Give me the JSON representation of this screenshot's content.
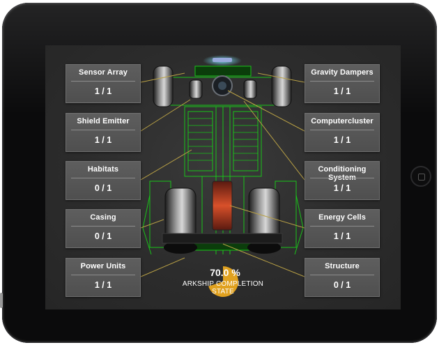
{
  "modules_left": [
    {
      "name": "Sensor Array",
      "count": "1 / 1"
    },
    {
      "name": "Shield Emitter",
      "count": "1 / 1"
    },
    {
      "name": "Habitats",
      "count": "0 / 1"
    },
    {
      "name": "Casing",
      "count": "0 / 1"
    },
    {
      "name": "Power Units",
      "count": "1 / 1"
    }
  ],
  "modules_right": [
    {
      "name": "Gravity Dampers",
      "count": "1 / 1"
    },
    {
      "name": "Computercluster",
      "count": "1 / 1"
    },
    {
      "name": "Conditioning System",
      "count": "1 / 1"
    },
    {
      "name": "Energy Cells",
      "count": "1 / 1"
    },
    {
      "name": "Structure",
      "count": "0 / 1"
    }
  ],
  "completion": {
    "value": 70.0,
    "value_text": "70.0 %",
    "label": "ARKSHIP COMPLETION STATE",
    "color": "#e0a11f"
  },
  "colors": {
    "card_bg": "#555555",
    "wireframe": "#19c419",
    "connector": "#b8a045",
    "screen_bg": "#2e2e2e"
  }
}
